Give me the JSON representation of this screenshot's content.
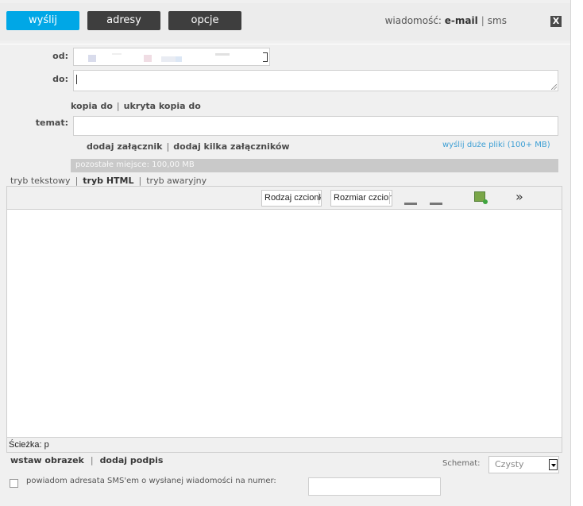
{
  "toolbar": {
    "send_label": "wyślij",
    "addresses_label": "adresy",
    "options_label": "opcje",
    "message_prefix": "wiadomość:",
    "email_label": "e-mail",
    "separator": "|",
    "sms_label": "sms",
    "close_label": "X"
  },
  "form": {
    "from_label": "od:",
    "to_label": "do:",
    "cc_label": "kopia do",
    "bcc_label": "ukryta kopia do",
    "subject_label": "temat:",
    "attach_label": "dodaj załącznik",
    "attach_many_label": "dodaj kilka załączników",
    "big_files_label": "wyślij duże pliki (100+ MB)",
    "quota_text": "pozostałe miejsce: 100,00 MB"
  },
  "modes": {
    "text": "tryb tekstowy",
    "html": "tryb HTML",
    "fallback": "tryb awaryjny"
  },
  "editor": {
    "font_family_value": "Rodzaj czcionki",
    "font_size_value": "Rozmiar czcionki",
    "path_text": "Ścieżka: p"
  },
  "footer": {
    "insert_image": "wstaw obrazek",
    "add_signature": "dodaj podpis",
    "schema_label": "Schemat:",
    "schema_value": "Czysty",
    "sms_notify": "powiadom adresata SMS'em o wysłanej wiadomości na numer:"
  },
  "colors": {
    "accent": "#00a7e6",
    "dark_button": "#3e3e3e",
    "link": "#3d9fd4"
  }
}
